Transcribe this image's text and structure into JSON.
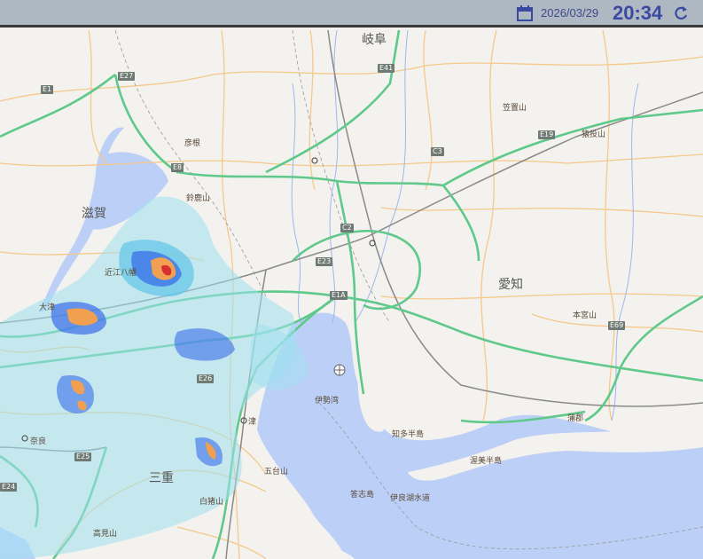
{
  "header": {
    "date": "2026/03/29",
    "time": "20:34",
    "calendar_icon": "calendar-icon",
    "refresh_icon": "refresh-icon",
    "accent_color": "#3b4aa0"
  },
  "map": {
    "colors": {
      "land": "#f3f2ee",
      "water": "#bcd0f7",
      "expressway": "#5ec98a",
      "road": "#f4c98a",
      "rail": "#8a8a8a",
      "rain_light": "#9fe0f0",
      "rain_moderate": "#3b6ee8",
      "rain_heavy": "#f0a050",
      "rain_intense": "#d83030"
    },
    "prefectures": [
      "岐阜",
      "滋賀",
      "愛知",
      "三重"
    ],
    "places": [
      "大津",
      "奈良",
      "津",
      "伊勢湾",
      "知多半島",
      "渥美半島",
      "伊良湖水道",
      "蒲郡",
      "答志島",
      "鈴鹿山",
      "笠置山",
      "猿投山",
      "本宮山",
      "高見山",
      "白猪山",
      "五台山",
      "近江八幡",
      "彦根"
    ],
    "routes": [
      "E1",
      "E1A",
      "E8",
      "E19",
      "E23",
      "E24",
      "E25",
      "E26",
      "E27",
      "E41",
      "E69",
      "C2",
      "C3"
    ]
  }
}
